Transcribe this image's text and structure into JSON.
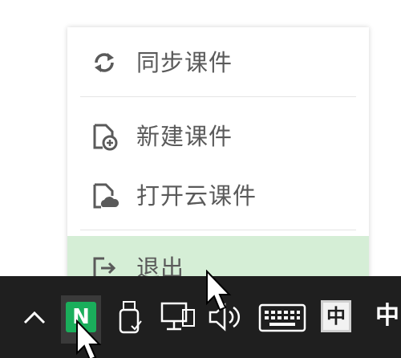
{
  "menu": {
    "items": [
      {
        "label": "同步课件",
        "icon": "sync-icon"
      },
      {
        "label": "新建课件",
        "icon": "new-file-icon"
      },
      {
        "label": "打开云课件",
        "icon": "cloud-file-icon"
      },
      {
        "label": "退出",
        "icon": "exit-icon"
      }
    ],
    "hover_color": "#d5eed6"
  },
  "taskbar": {
    "app_badge": "N",
    "app_color": "#1aae5b",
    "ime_label": "中",
    "partial_label": "中"
  }
}
